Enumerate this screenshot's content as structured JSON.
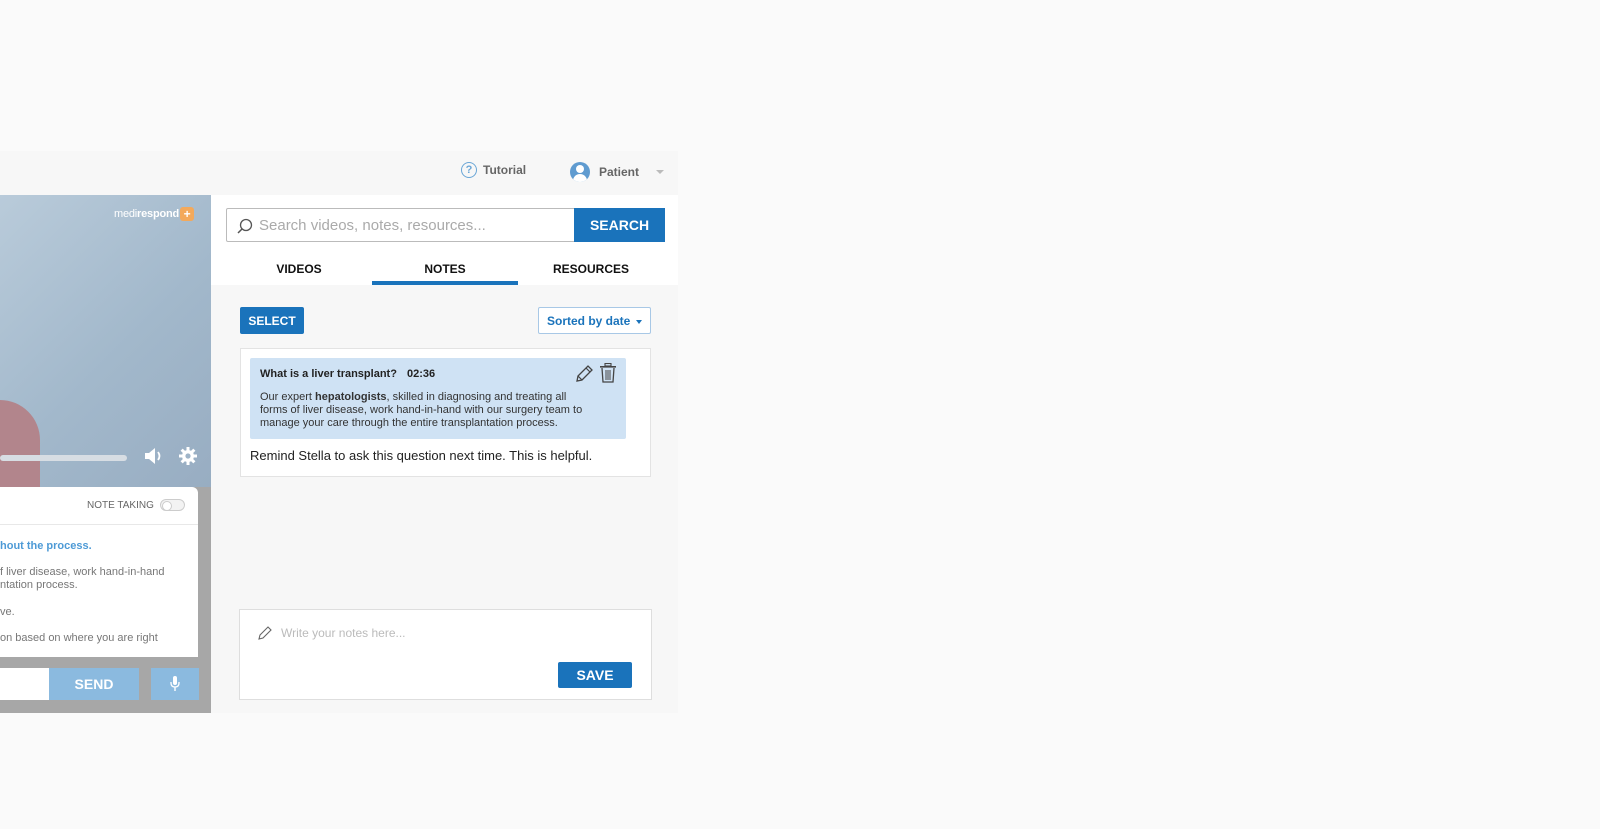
{
  "header": {
    "tutorial_label": "Tutorial",
    "user_label": "Patient"
  },
  "video": {
    "logo_light": "medi",
    "logo_bold": "respond",
    "logo_plus": "+"
  },
  "chat": {
    "note_taking_label": "NOTE TAKING",
    "lines": [
      "hout the process.",
      "f liver disease, work hand-in-hand",
      "ntation process.",
      "ve.",
      "on based on where you are right"
    ],
    "send_label": "SEND"
  },
  "search": {
    "placeholder": "Search videos, notes, resources...",
    "button_label": "SEARCH"
  },
  "tabs": [
    {
      "label": "VIDEOS"
    },
    {
      "label": "NOTES"
    },
    {
      "label": "RESOURCES"
    }
  ],
  "notes": {
    "select_label": "SELECT",
    "sort_label": "Sorted by date",
    "items": [
      {
        "title": "What is a liver transplant?",
        "time": "02:36",
        "quote_prefix": "Our expert ",
        "quote_bold": "hepatologists",
        "quote_line1_rest": ", skilled in diagnosing and treating all",
        "quote_line2": "forms of liver disease, work hand-in-hand with our surgery team to",
        "quote_line3": "manage your care through the entire transplantation process.",
        "note": "Remind Stella to ask this question next time. This is helpful."
      }
    ],
    "write_placeholder": "Write your notes here...",
    "save_label": "SAVE"
  },
  "colors": {
    "primary": "#1a73bb",
    "light_blue": "#8bbadf",
    "quote_bg": "#cfe2f4"
  }
}
